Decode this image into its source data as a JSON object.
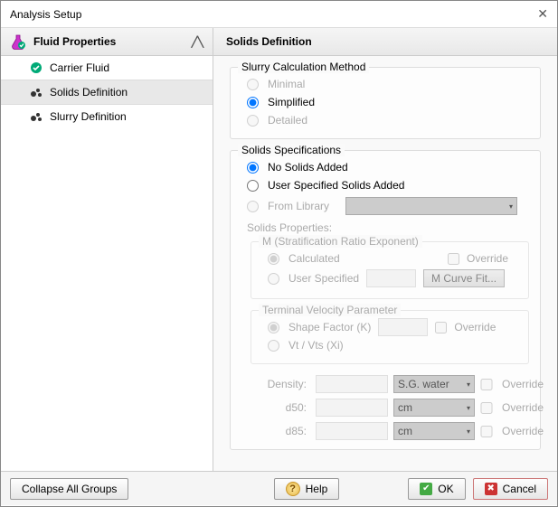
{
  "window": {
    "title": "Analysis Setup"
  },
  "sidebar": {
    "group_label": "Fluid Properties",
    "items": [
      {
        "label": "Carrier Fluid"
      },
      {
        "label": "Solids Definition"
      },
      {
        "label": "Slurry Definition"
      }
    ]
  },
  "content": {
    "header": "Solids Definition",
    "slurry_method": {
      "title": "Slurry Calculation Method",
      "minimal": "Minimal",
      "simplified": "Simplified",
      "detailed": "Detailed",
      "selected": "simplified"
    },
    "solids_spec": {
      "title": "Solids Specifications",
      "no_solids": "No Solids Added",
      "user_spec": "User Specified Solids Added",
      "from_library": "From Library",
      "solids_props": "Solids Properties:",
      "m_title": "M (Stratification Ratio Exponent)",
      "calculated": "Calculated",
      "user_specified": "User Specified",
      "override": "Override",
      "m_curve": "M Curve Fit...",
      "tv_title": "Terminal Velocity Parameter",
      "shape_k": "Shape Factor (K)",
      "vt_vts": "Vt / Vts (Xi)",
      "density": "Density:",
      "d50": "d50:",
      "d85": "d85:",
      "unit_sg": "S.G. water",
      "unit_cm": "cm"
    }
  },
  "footer": {
    "collapse": "Collapse All Groups",
    "help": "Help",
    "ok": "OK",
    "cancel": "Cancel"
  }
}
